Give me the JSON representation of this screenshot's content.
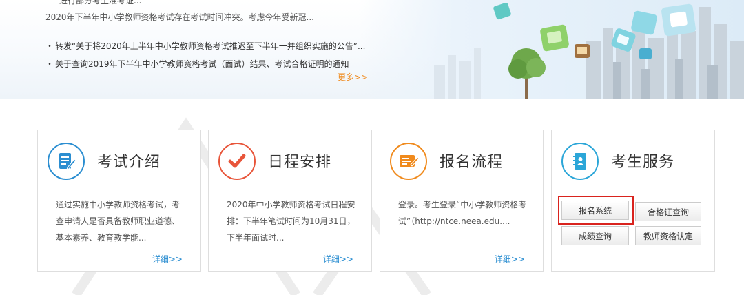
{
  "news": {
    "cut_line": "进行部分考生准考证...",
    "summary": "2020年下半年中小学教师资格考试存在考试时间冲突。考虑今年受新冠...",
    "items": [
      {
        "bullet": "・",
        "text": "转发“关于将2020年上半年中小学教师资格考试推迟至下半年一并组织实施的公告”..."
      },
      {
        "bullet": "・",
        "text": "关于查询2019年下半年中小学教师资格考试（面试）结果、考试合格证明的通知"
      }
    ],
    "more": "更多>>"
  },
  "cards": [
    {
      "title": "考试介绍",
      "icon": "document-edit-icon",
      "color": "#2b8ed1",
      "desc": "通过实施中小学教师资格考试，考查申请人是否具备教师职业道德、基本素养、教育教学能...",
      "detail": "详细>>"
    },
    {
      "title": "日程安排",
      "icon": "checkmark-icon",
      "color": "#e8553a",
      "desc": "2020年中小学教师资格考试日程安排：下半年笔试时间为10月31日，下半年面试时...",
      "detail": "详细>>"
    },
    {
      "title": "报名流程",
      "icon": "form-pencil-icon",
      "color": "#f08a1c",
      "desc": "登录。考生登录“中小学教师资格考试”（http://ntce.neea.edu....",
      "detail": "详细>>"
    },
    {
      "title": "考生服务",
      "icon": "notebook-user-icon",
      "color": "#2ba6d8"
    }
  ],
  "services": {
    "register": "报名系统",
    "certificate": "合格证查询",
    "score": "成绩查询",
    "qualification": "教师资格认定"
  },
  "colors": {
    "highlight": "#d9231e",
    "link": "#2b8ed1",
    "more": "#f08a1c"
  }
}
